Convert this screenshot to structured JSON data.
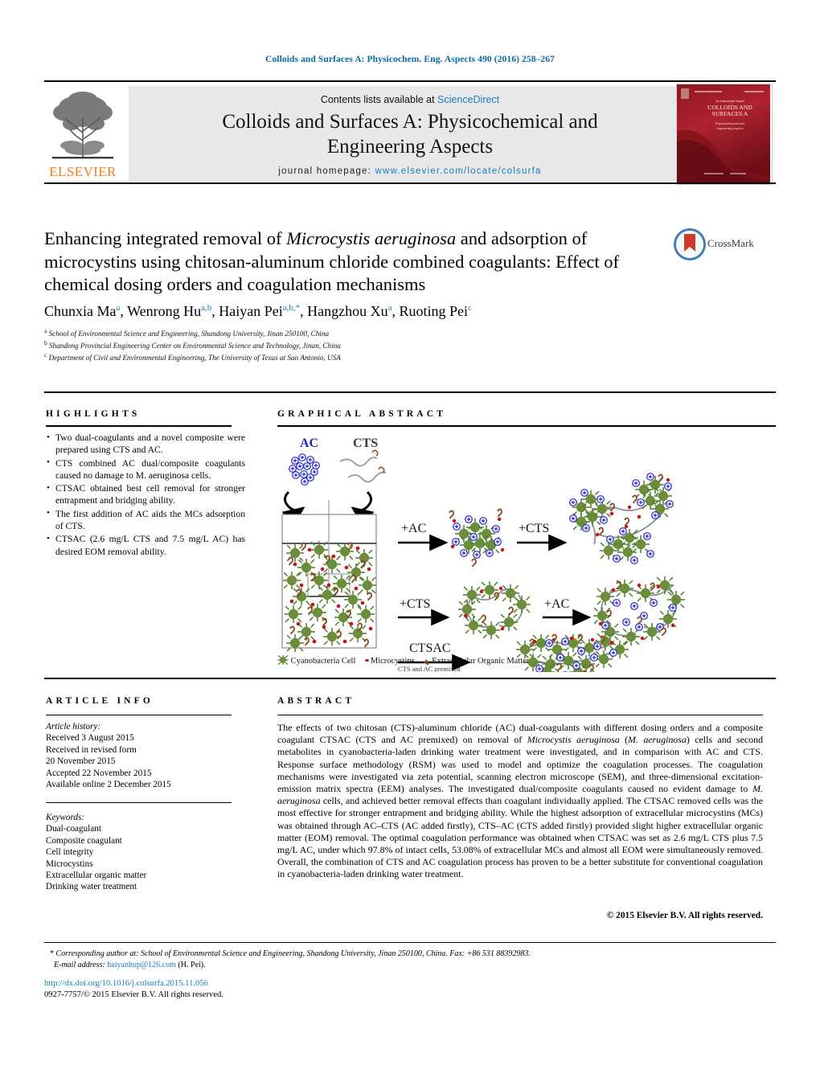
{
  "running_head": "Colloids and Surfaces A: Physicochem. Eng. Aspects 490 (2016) 258–267",
  "banner": {
    "contents_prefix": "Contents lists available at ",
    "sciencedirect": "ScienceDirect",
    "journal_title_line1": "Colloids and Surfaces A: Physicochemical and",
    "journal_title_line2": "Engineering Aspects",
    "homepage_label": "journal homepage:",
    "homepage_url": "www.elsevier.com/locate/colsurfa",
    "publisher": "ELSEVIER",
    "cover_title_line1": "COLLOIDS AND",
    "cover_title_line2": "SURFACES A",
    "cover_sub1": "Physicochemical and",
    "cover_sub2": "engineering aspects",
    "cover_kicker": "An International Journal"
  },
  "article": {
    "title_part1": "Enhancing integrated removal of ",
    "title_italic1": "Microcystis aeruginosa",
    "title_part2": " and adsorption of microcystins using chitosan-aluminum chloride combined coagulants: Effect of chemical dosing orders and coagulation mechanisms",
    "authors": [
      {
        "name": "Chunxia Ma",
        "marks": "a",
        "sep": ", "
      },
      {
        "name": "Wenrong Hu",
        "marks": "a,b",
        "sep": ", "
      },
      {
        "name": "Haiyan Pei",
        "marks": "a,b,*",
        "sep": ", "
      },
      {
        "name": "Hangzhou Xu",
        "marks": "a",
        "sep": ", "
      },
      {
        "name": "Ruoting Pei",
        "marks": "c",
        "sep": ""
      }
    ],
    "affiliations": [
      {
        "mark": "a",
        "text": "School of Environmental Science and Engineering, Shandong University, Jinan 250100, China"
      },
      {
        "mark": "b",
        "text": "Shandong Provincial Engineering Center on Environmental Science and Technology, Jinan, China"
      },
      {
        "mark": "c",
        "text": "Department of Civil and Environmental Engineering, The University of Texas at San Antonio, USA"
      }
    ],
    "crossmark_label": "CrossMark"
  },
  "sections": {
    "highlights_heading": "HIGHLIGHTS",
    "graphical_abstract_heading": "GRAPHICAL ABSTRACT",
    "article_info_heading": "ARTICLE INFO",
    "abstract_heading": "ABSTRACT"
  },
  "highlights": [
    "Two dual-coagulants and a novel composite were prepared using CTS and AC.",
    "CTS combined AC dual/composite coagulants caused no damage to M. aeruginosa cells.",
    "CTSAC obtained best cell removal for stronger entrapment and bridging ability.",
    "The first addition of AC aids the MCs adsorption of CTS.",
    "CTSAC (2.6 mg/L CTS and 7.5 mg/L AC) has desired EOM removal ability."
  ],
  "graphical_abstract": {
    "label_ac": "AC",
    "label_cts": "CTS",
    "arrow_1": "+AC",
    "arrow_2": "+CTS",
    "arrow_3": "+CTS",
    "arrow_4": "+AC",
    "arrow_5": "CTSAC",
    "arrow_5_sub": "CTS and AC premixed",
    "legend": [
      {
        "icon": "cyanobacteria-cell-icon",
        "label": "Cyanobacteria Cell",
        "color": "#6b8e3a"
      },
      {
        "icon": "microcystin-icon",
        "label": "Microcystins",
        "color": "#cc1111"
      },
      {
        "icon": "eom-icon",
        "label": "Extracellular Organic Matter",
        "color": "#8a4b1e"
      }
    ]
  },
  "article_info": {
    "history_label": "Article history:",
    "history": [
      "Received 3 August 2015",
      "Received in revised form",
      "20 November 2015",
      "Accepted 22 November 2015",
      "Available online 2 December 2015"
    ],
    "keywords_label": "Keywords:",
    "keywords": [
      "Dual-coagulant",
      "Composite coagulant",
      "Cell integrity",
      "Microcystins",
      "Extracellular organic matter",
      "Drinking water treatment"
    ]
  },
  "abstract": {
    "p1": "The effects of two chitosan (CTS)-aluminum chloride (AC) dual-coagulants with different dosing orders and a composite coagulant CTSAC (CTS and AC premixed) on removal of ",
    "italic1": "Microcystis aeruginosa",
    "p2": " (",
    "italic2": "M. aeruginosa",
    "p3": ") cells and second metabolites in cyanobacteria-laden drinking water treatment were investigated, and in comparison with AC and CTS. Response surface methodology (RSM) was used to model and optimize the coagulation processes. The coagulation mechanisms were investigated via zeta potential, scanning electron microscope (SEM), and three-dimensional excitation-emission matrix spectra (EEM) analyses. The investigated dual/composite coagulants caused no evident damage to ",
    "italic3": "M. aeruginosa",
    "p4": " cells, and achieved better removal effects than coagulant individually applied. The CTSAC removed cells was the most effective for stronger entrapment and bridging ability. While the highest adsorption of extracellular microcystins (MCs) was obtained through AC–CTS (AC added firstly), CTS–AC (CTS added firstly) provided slight higher extracellular organic matter (EOM) removal. The optimal coagulation performance was obtained when CTSAC was set as 2.6 mg/L CTS plus 7.5 mg/L AC, under which 97.8% of intact cells, 53.08% of extracellular MCs and almost all EOM were simultaneously removed. Overall, the combination of CTS and AC coagulation process has proven to be a better substitute for conventional coagulation in cyanobacteria-laden drinking water treatment.",
    "copyright": "© 2015 Elsevier B.V. All rights reserved."
  },
  "footer": {
    "corresponding_marker": "*",
    "corresponding_text": "Corresponding author at: School of Environmental Science and Engineering, Shandong University, Jinan 250100, China. Fax: +86 531 88392983.",
    "email_label": "E-mail address:",
    "email": "haiyanhup@126.com",
    "email_owner": "(H. Pei).",
    "doi": "http://dx.doi.org/10.1016/j.colsurfa.2015.11.056",
    "issn": "0927-7757/© 2015 Elsevier B.V. All rights reserved."
  },
  "colors": {
    "link_blue": "#1b7bbd",
    "elsevier_orange": "#ef7c20",
    "banner_grey": "#e9e9e9",
    "cell_green": "#6b8e3a",
    "ac_blue": "#2222cc",
    "mc_red": "#cc1111",
    "eom_brown": "#8a4b1e"
  }
}
